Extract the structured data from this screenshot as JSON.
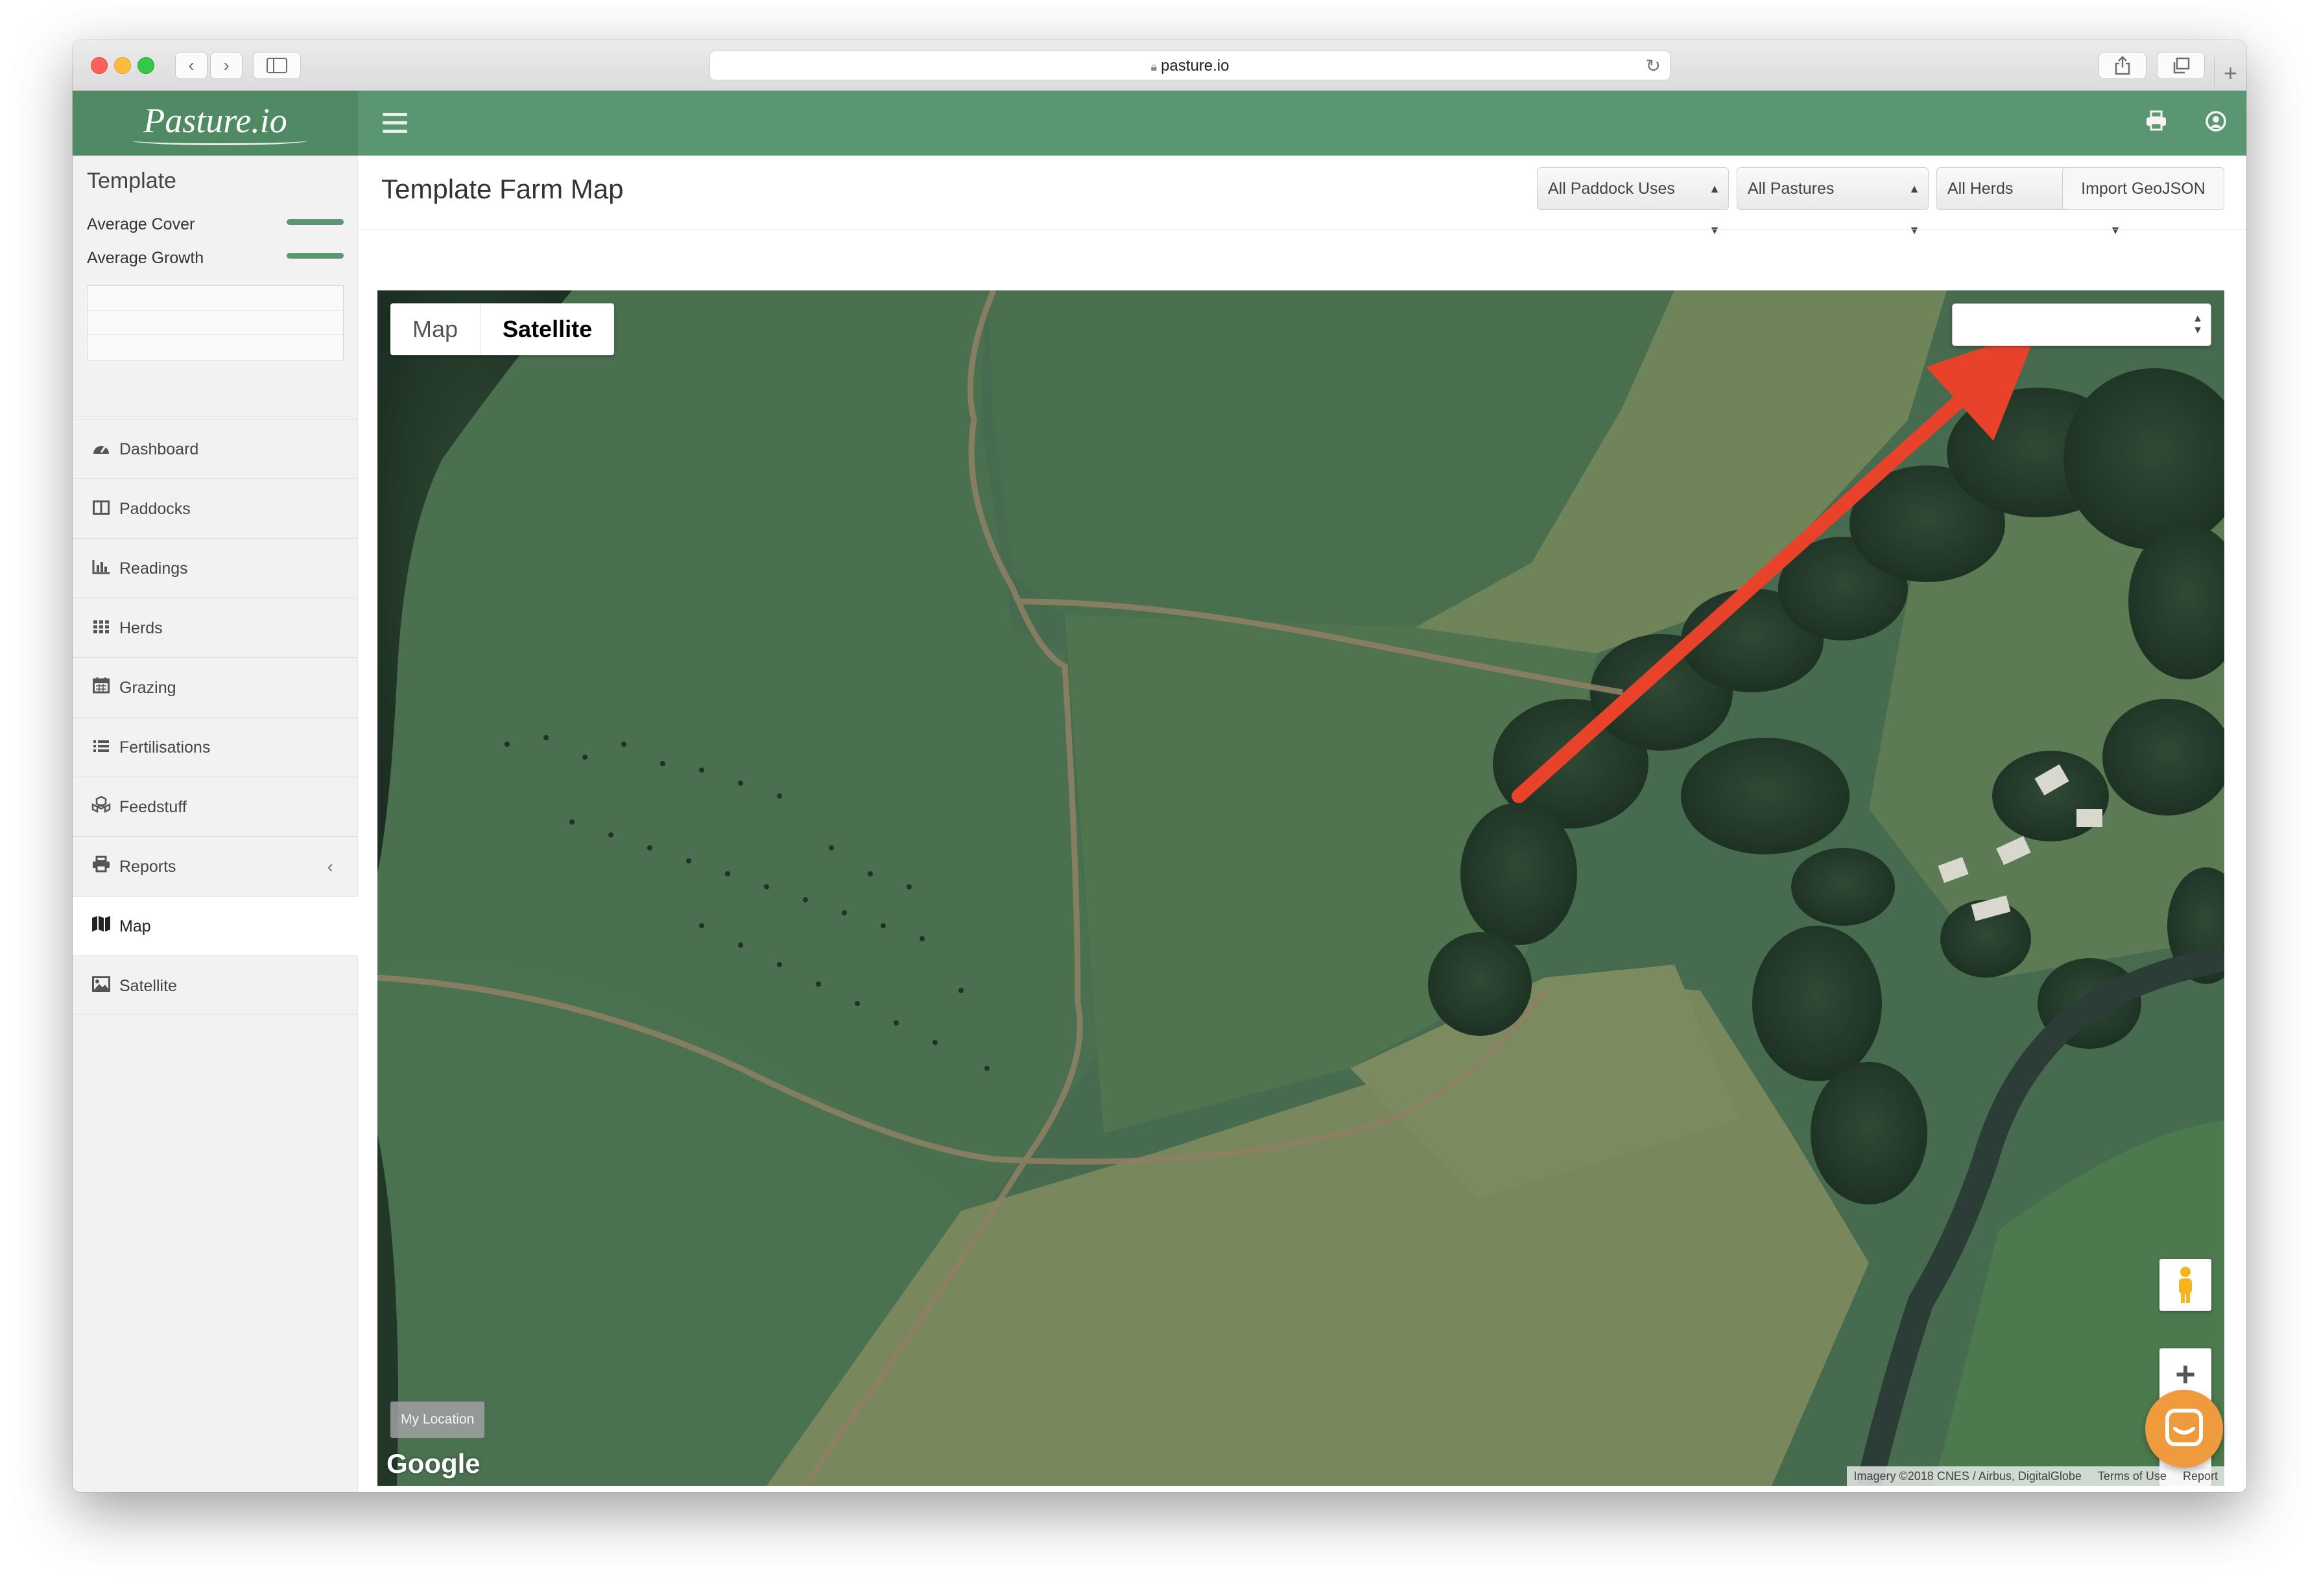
{
  "browser": {
    "url": "pasture.io"
  },
  "header": {
    "logo": "Pasture.io",
    "menu_icon": "hamburger-icon",
    "print_icon": "printer-icon",
    "user_icon": "user-icon"
  },
  "sidebar": {
    "title": "Template",
    "stats": [
      {
        "label": "Average Cover"
      },
      {
        "label": "Average Growth"
      }
    ],
    "nav": [
      {
        "label": "Dashboard",
        "icon": "tachometer-icon"
      },
      {
        "label": "Paddocks",
        "icon": "columns-icon"
      },
      {
        "label": "Readings",
        "icon": "bar-chart-icon"
      },
      {
        "label": "Herds",
        "icon": "grid-icon"
      },
      {
        "label": "Grazing",
        "icon": "calendar-icon"
      },
      {
        "label": "Fertilisations",
        "icon": "list-icon"
      },
      {
        "label": "Feedstuff",
        "icon": "cubes-icon"
      },
      {
        "label": "Reports",
        "icon": "printer-icon"
      },
      {
        "label": "Map",
        "icon": "map-icon"
      },
      {
        "label": "Satellite",
        "icon": "image-icon"
      }
    ]
  },
  "main": {
    "title": "Template Farm Map",
    "filters": {
      "paddock_uses": "All Paddock Uses",
      "pastures": "All Pastures",
      "herds": "All Herds"
    },
    "import_button": "Import GeoJSON"
  },
  "map": {
    "type_map": "Map",
    "type_satellite": "Satellite",
    "my_location": "My Location",
    "google": "Google",
    "attribution": "Imagery ©2018 CNES / Airbus, DigitalGlobe",
    "terms": "Terms of Use",
    "report": "Report",
    "zoom_in": "+",
    "zoom_out": "−"
  },
  "colors": {
    "brand_green": "#5a9671",
    "logo_bg": "#4f8a64",
    "arrow_red": "#e8432a",
    "chat_orange": "#ee9a3d"
  }
}
